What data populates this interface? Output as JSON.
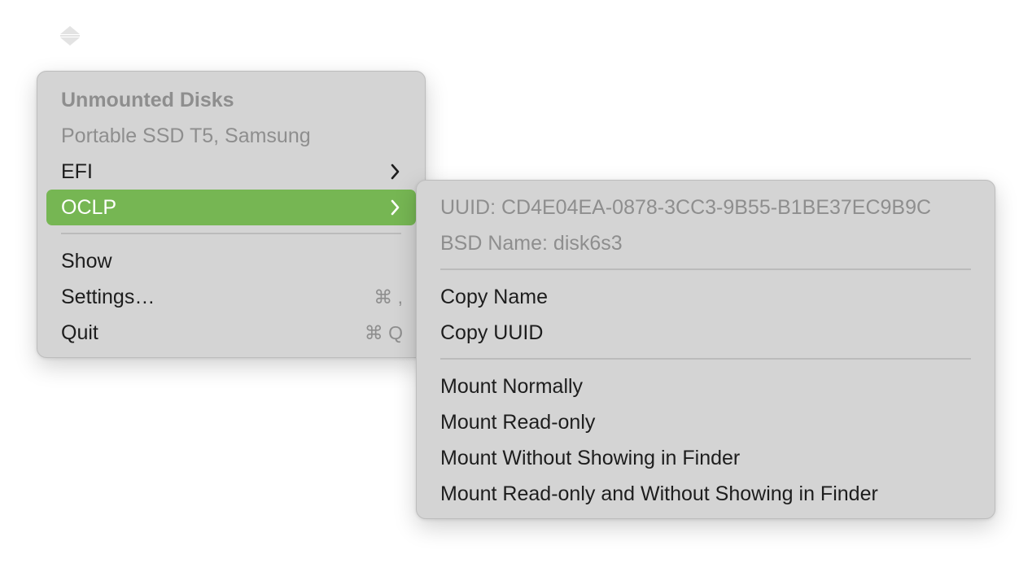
{
  "status_icon": "chevron-up-down-icon",
  "main_menu": {
    "header": "Unmounted Disks",
    "device": "Portable SSD T5, Samsung",
    "efi": "EFI",
    "oclp": "OCLP",
    "show": "Show",
    "settings": "Settings…",
    "settings_shortcut": "⌘ ,",
    "quit": "Quit",
    "quit_shortcut": "⌘ Q"
  },
  "sub_menu": {
    "uuid": "UUID: CD4E04EA-0878-3CC3-9B55-B1BE37EC9B9C",
    "bsd_name": "BSD Name: disk6s3",
    "copy_name": "Copy Name",
    "copy_uuid": "Copy UUID",
    "mount_normally": "Mount Normally",
    "mount_read_only": "Mount Read-only",
    "mount_without_finder": "Mount Without Showing in Finder",
    "mount_read_only_without_finder": "Mount Read-only and Without Showing in Finder"
  },
  "colors": {
    "selection": "#76b653",
    "menu_background": "#d4d4d4",
    "disabled_text": "#8e8e8e"
  }
}
